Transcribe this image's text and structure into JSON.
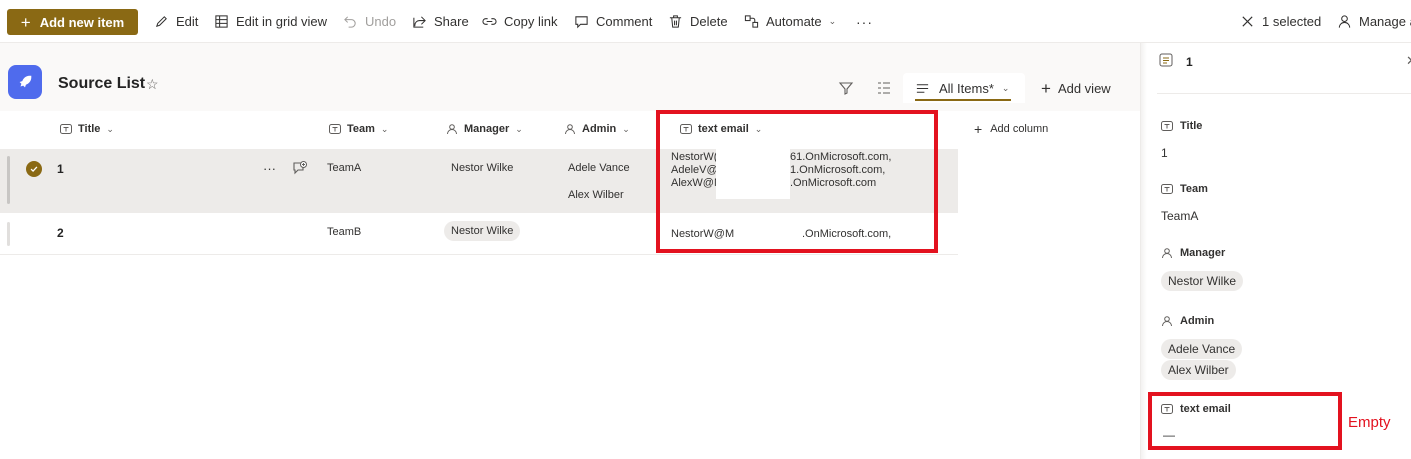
{
  "toolbar": {
    "add_new_item": "Add new item",
    "edit": "Edit",
    "edit_grid": "Edit in grid view",
    "undo": "Undo",
    "share": "Share",
    "copy_link": "Copy link",
    "comment": "Comment",
    "delete": "Delete",
    "automate": "Automate",
    "more": "···",
    "selected": "1 selected",
    "manage_access": "Manage a"
  },
  "list": {
    "title": "Source List",
    "views": {
      "active_view": "All Items*",
      "add_view": "Add view"
    },
    "columns": {
      "title": "Title",
      "team": "Team",
      "manager": "Manager",
      "admin": "Admin",
      "text_email": "text email",
      "add_column": "Add column"
    },
    "rows": [
      {
        "title": "1",
        "more": "···",
        "team": "TeamA",
        "manager": "Nestor Wilke",
        "admins": [
          "Adele Vance",
          "Alex Wilber"
        ],
        "email_prefixes": [
          "NestorW(",
          "AdeleV@",
          "AlexW@M"
        ],
        "email_suffixes": [
          "61.OnMicrosoft.com,",
          "1.OnMicrosoft.com,",
          ".OnMicrosoft.com"
        ]
      },
      {
        "title": "2",
        "team": "TeamB",
        "manager": "Nestor Wilke",
        "admins": [],
        "email_prefixes": [
          "NestorW@M"
        ],
        "email_suffixes": [
          ".OnMicrosoft.com,"
        ]
      }
    ]
  },
  "details": {
    "item_id": "1",
    "fields": {
      "title_label": "Title",
      "title_value": "1",
      "team_label": "Team",
      "team_value": "TeamA",
      "manager_label": "Manager",
      "manager_value": "Nestor Wilke",
      "admin_label": "Admin",
      "admin_values": [
        "Adele Vance",
        "Alex Wilber"
      ],
      "email_label": "text email",
      "email_value": "—"
    }
  },
  "annotation": "Empty",
  "colors": {
    "accent": "#8a6914",
    "highlight_red": "#e3121f",
    "list_icon": "#4f6bed",
    "selected_row": "#edebe9"
  }
}
